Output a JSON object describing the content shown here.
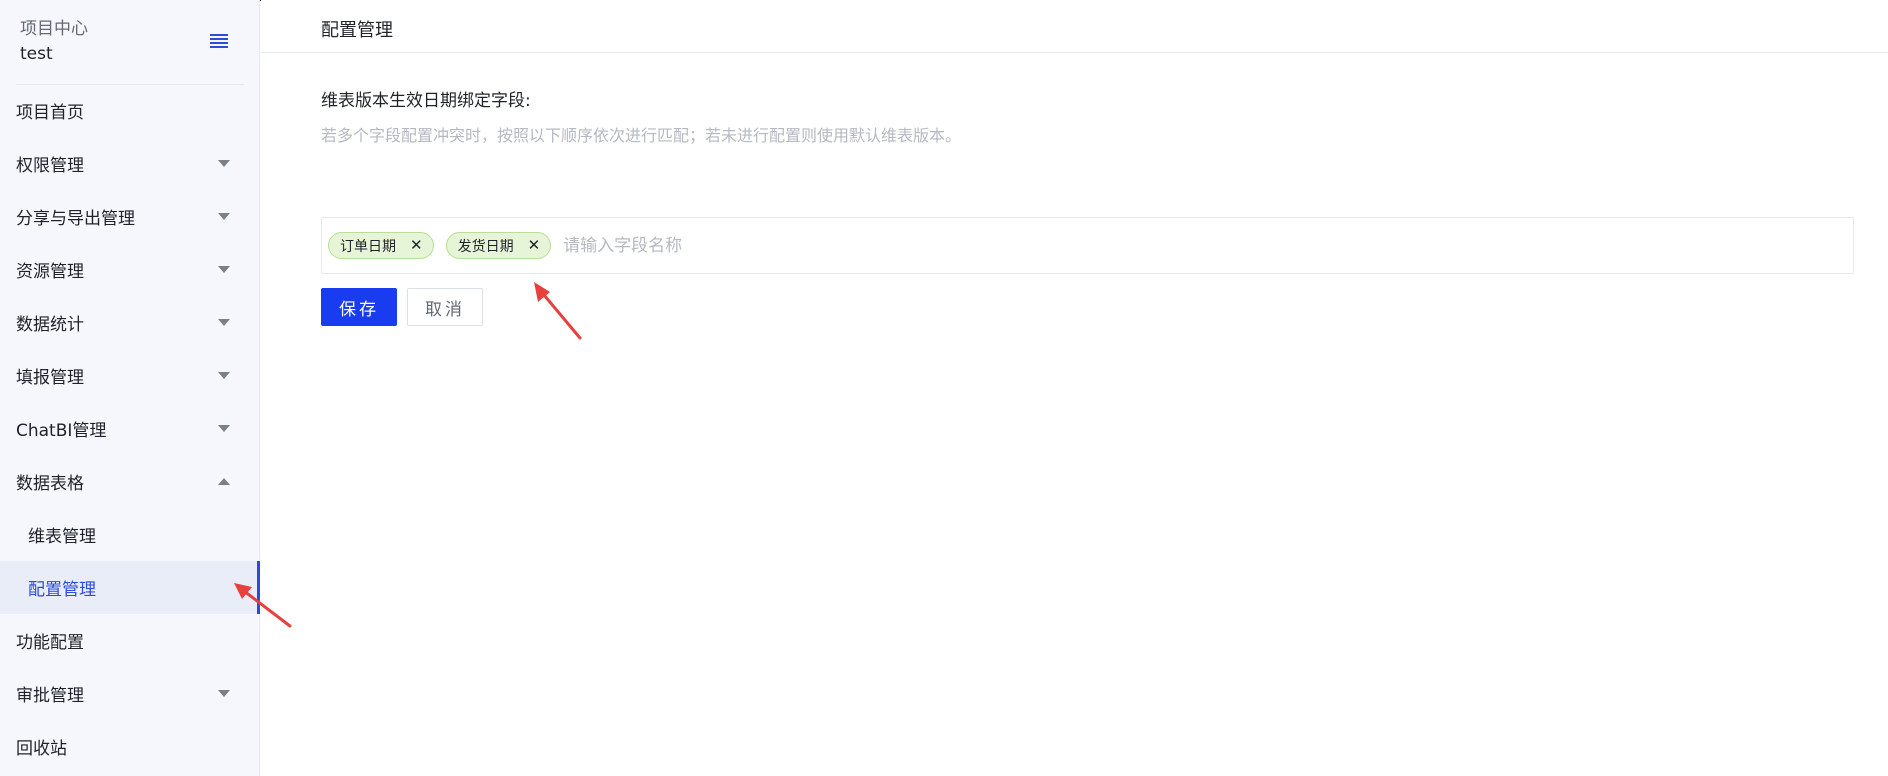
{
  "sidebar": {
    "project_label": "项目中心",
    "project_name": "test",
    "items": [
      {
        "label": "项目首页",
        "expandable": false
      },
      {
        "label": "权限管理",
        "expandable": true
      },
      {
        "label": "分享与导出管理",
        "expandable": true
      },
      {
        "label": "资源管理",
        "expandable": true
      },
      {
        "label": "数据统计",
        "expandable": true
      },
      {
        "label": "填报管理",
        "expandable": true
      },
      {
        "label": "ChatBI管理",
        "expandable": true
      },
      {
        "label": "数据表格",
        "expandable": true,
        "expanded": true
      },
      {
        "label": "维表管理",
        "sub": true
      },
      {
        "label": "配置管理",
        "sub": true,
        "active": true
      },
      {
        "label": "功能配置",
        "expandable": false
      },
      {
        "label": "审批管理",
        "expandable": true
      },
      {
        "label": "回收站",
        "expandable": false
      }
    ]
  },
  "main": {
    "title": "配置管理",
    "field_label": "维表版本生效日期绑定字段:",
    "field_hint": "若多个字段配置冲突时，按照以下顺序依次进行匹配；若未进行配置则使用默认维表版本。",
    "tags": [
      "订单日期",
      "发货日期"
    ],
    "tag_close_glyph": "✕",
    "input_placeholder": "请输入字段名称",
    "save_label": "保存",
    "cancel_label": "取消"
  },
  "colors": {
    "accent": "#1a3cf0",
    "tag_bg": "#e6f4d7",
    "annotation_arrow": "#e8413d"
  }
}
